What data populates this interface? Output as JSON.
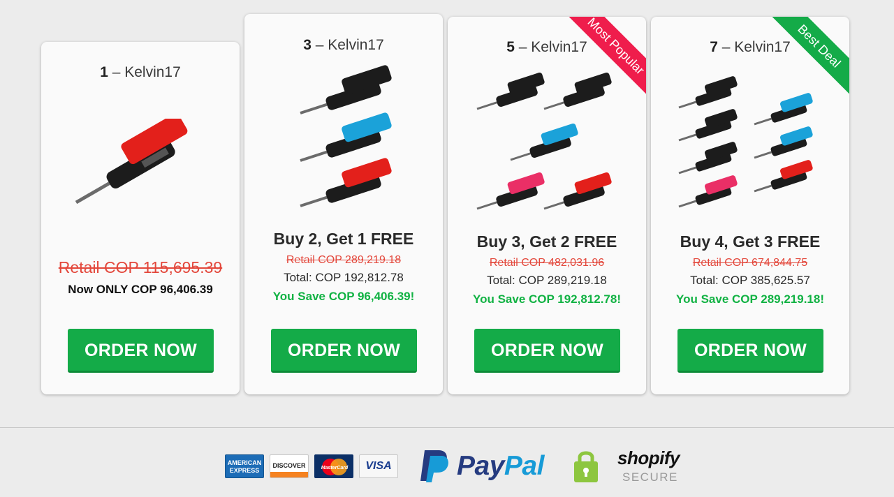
{
  "packages": [
    {
      "qty": "1",
      "name": "– Kelvin17",
      "offer": "",
      "retail": "Retail COP 115,695.39",
      "total": "Now ONLY COP 96,406.39",
      "save": "",
      "button": "ORDER NOW",
      "ribbon": "",
      "image": "1-screwdriver-red"
    },
    {
      "qty": "3",
      "name": "– Kelvin17",
      "offer": "Buy 2, Get 1 FREE",
      "retail": "Retail COP 289,219.18",
      "total": "Total: COP 192,812.78",
      "save": "You Save COP 96,406.39!",
      "button": "ORDER NOW",
      "ribbon": "",
      "image": "3-screwdrivers"
    },
    {
      "qty": "5",
      "name": "– Kelvin17",
      "offer": "Buy 3, Get 2 FREE",
      "retail": "Retail COP 482,031.96",
      "total": "Total: COP 289,219.18",
      "save": "You Save COP 192,812.78!",
      "button": "ORDER NOW",
      "ribbon": "Most Popular",
      "image": "5-screwdrivers"
    },
    {
      "qty": "7",
      "name": "– Kelvin17",
      "offer": "Buy 4, Get 3 FREE",
      "retail": "Retail COP 674,844.75",
      "total": "Total: COP 385,625.57",
      "save": "You Save COP 289,219.18!",
      "button": "ORDER NOW",
      "ribbon": "Best Deal",
      "image": "7-screwdrivers"
    }
  ],
  "footer": {
    "cards": {
      "amex": "AMERICAN EXPRESS",
      "discover": "DISCOVER",
      "mastercard": "MasterCard",
      "visa": "VISA"
    },
    "paypal_a": "Pay",
    "paypal_b": "Pal",
    "shopify": "shopify",
    "secure": "SECURE"
  },
  "colors": {
    "green": "#14ab48",
    "red_ribbon": "#ef1d4c",
    "retail_red": "#e3473b",
    "save_green": "#11b243"
  }
}
